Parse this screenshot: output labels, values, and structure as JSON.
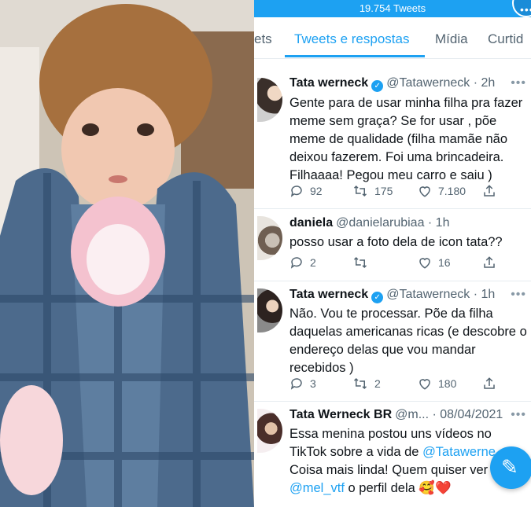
{
  "header": {
    "tweet_count": "19.754 Tweets"
  },
  "tabs": [
    {
      "label": "ets"
    },
    {
      "label": "Tweets e respostas",
      "active": true
    },
    {
      "label": "Mídia"
    },
    {
      "label": "Curtid"
    }
  ],
  "tweets": [
    {
      "name": "Tata werneck",
      "verified": true,
      "handle": "@Tatawerneck · 2h",
      "text": "Gente para de usar minha filha pra fazer meme sem graça? Se for usar , põe meme de qualidade (filha mamãe não deixou fazerem. Foi uma brincadeira. Filhaaaa! Pegou meu carro e saiu )",
      "replies": "92",
      "retweets": "175",
      "likes": "7.180"
    },
    {
      "name": "daniela",
      "handle": "@danielarubiaa · 1h",
      "text": "posso usar a foto dela de icon tata??",
      "replies": "2",
      "retweets": "",
      "likes": "16"
    },
    {
      "name": "Tata werneck",
      "verified": true,
      "handle": "@Tatawerneck · 1h",
      "text": "Não. Vou te processar. Põe da filha daquelas americanas ricas (e descobre o endereço delas que vou mandar recebidos )",
      "replies": "3",
      "retweets": "2",
      "likes": "180"
    },
    {
      "name": "Tata Werneck BR",
      "handle": "@m... · 08/04/2021",
      "text_parts": {
        "p1": "Essa menina postou uns vídeos no TikTok sobre a vida de ",
        "m1": "@Tatawerne",
        "p2": " Coisa mais linda! Quem quiser ver ",
        "m2": "@mel_vtf",
        "p3": " o perfil dela 🥰❤️"
      }
    }
  ],
  "colors": {
    "accent": "#1da1f2",
    "text": "#0f1419",
    "muted": "#536471"
  },
  "icons": [
    "reply-icon",
    "retweet-icon",
    "like-icon",
    "share-icon",
    "verified-icon",
    "compose-icon",
    "more-icon"
  ]
}
